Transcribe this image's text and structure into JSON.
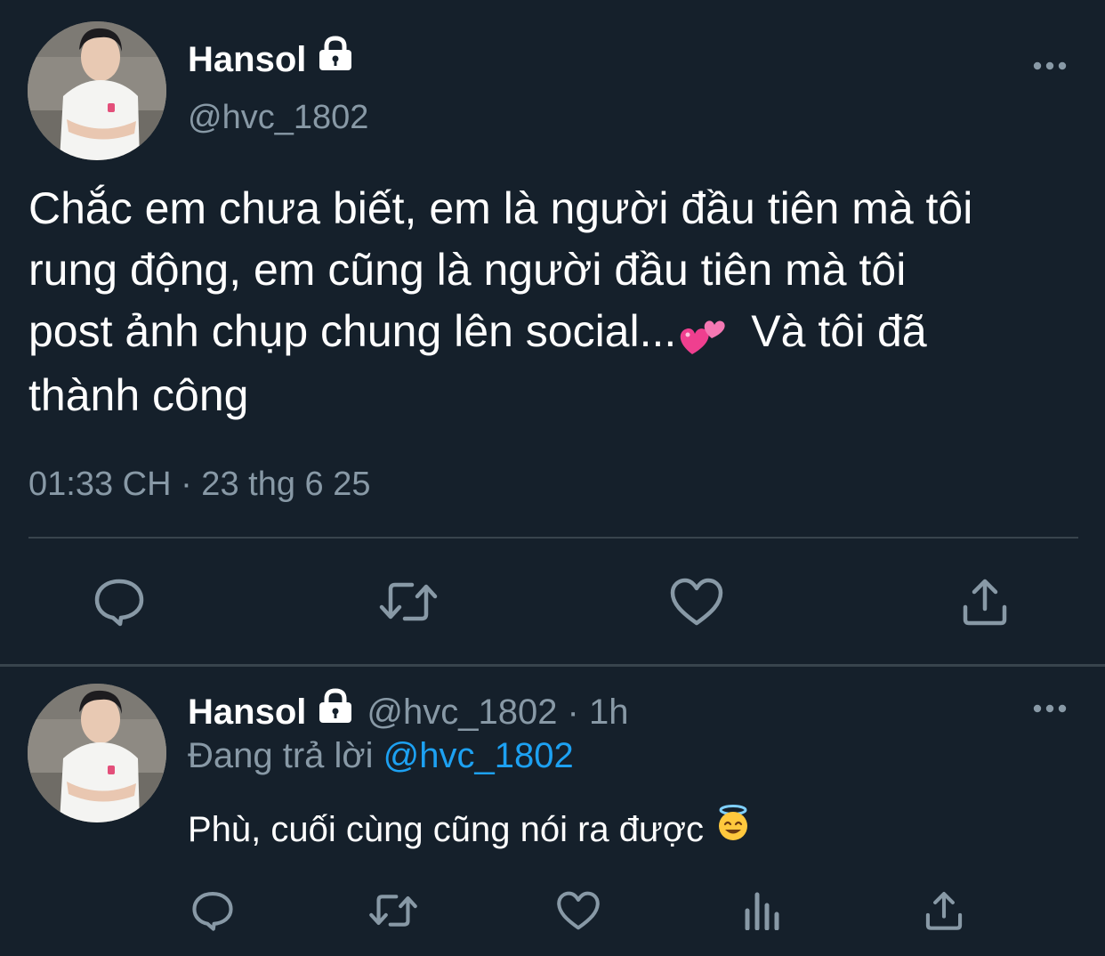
{
  "main_tweet": {
    "display_name": "Hansol",
    "handle": "@hvc_1802",
    "text_lines": [
      "Chắc em chưa biết, em là người đầu tiên mà tôi",
      "rung động, em cũng là người đầu tiên mà tôi",
      "post ảnh chụp chung lên social...",
      "Và tôi đã",
      "thành công"
    ],
    "inline_emoji": "two-hearts",
    "timestamp": "01:33 CH · 23 thg 6 25",
    "actions": [
      "reply-icon",
      "retweet-icon",
      "like-icon",
      "share-icon"
    ]
  },
  "reply_tweet": {
    "display_name": "Hansol",
    "handle_meta": "@hvc_1802 · 1h",
    "replying_to_label": "Đang trả lời",
    "replying_to_handle": "@hvc_1802",
    "text": "Phù, cuối cùng cũng nói ra được",
    "inline_emoji": "smiling-face-with-halo",
    "actions": [
      "reply-icon",
      "retweet-icon",
      "like-icon",
      "analytics-icon",
      "share-icon"
    ]
  },
  "colors": {
    "background": "#15202b",
    "primary_text": "#ffffff",
    "secondary_text": "#8899a6",
    "link": "#1da1f2",
    "divider": "#38444d"
  }
}
